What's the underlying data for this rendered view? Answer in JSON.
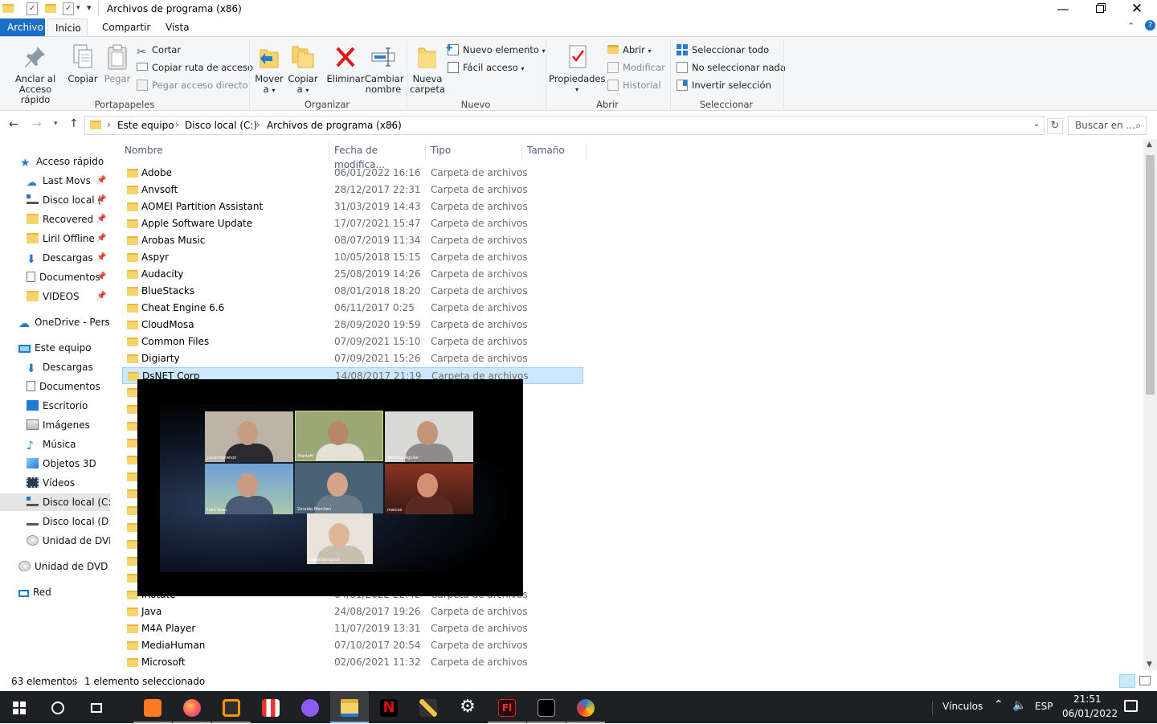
{
  "window": {
    "title": "Archivos de programa (x86)",
    "minimize_icon": "minimize-icon",
    "maximize_icon": "restore-icon",
    "close_icon": "close-icon"
  },
  "ribbon_tabs": [
    "Archivo",
    "Inicio",
    "Compartir",
    "Vista"
  ],
  "ribbon": {
    "clipboard": {
      "pin_label_1": "Anclar al",
      "pin_label_2": "Acceso rápido",
      "copy": "Copiar",
      "paste": "Pegar",
      "cut": "Cortar",
      "copy_path": "Copiar ruta de acceso",
      "paste_shortcut": "Pegar acceso directo",
      "group": "Portapapeles"
    },
    "organize": {
      "move_1": "Mover",
      "move_2": "a",
      "copy_1": "Copiar",
      "copy_2": "a",
      "delete": "Eliminar",
      "rename_1": "Cambiar",
      "rename_2": "nombre",
      "group": "Organizar"
    },
    "new": {
      "new_folder_1": "Nueva",
      "new_folder_2": "carpeta",
      "new_item": "Nuevo elemento",
      "easy_access": "Fácil acceso",
      "group": "Nuevo"
    },
    "open": {
      "properties": "Propiedades",
      "open": "Abrir",
      "edit": "Modificar",
      "history": "Historial",
      "group": "Abrir"
    },
    "select": {
      "select_all": "Seleccionar todo",
      "select_none": "No seleccionar nada",
      "invert": "Invertir selección",
      "group": "Seleccionar"
    }
  },
  "address": {
    "crumbs": [
      "Este equipo",
      "Disco local (C:)",
      "Archivos de programa (x86)"
    ],
    "search_placeholder": "Buscar en ..."
  },
  "nav_pane": {
    "quick_access": "Acceso rápido",
    "pinned": [
      "Last Movs",
      "Disco local (",
      "Recovered",
      "Liril Offline",
      "Descargas",
      "Documentos",
      "VIDEOS"
    ],
    "onedrive": "OneDrive - Perso",
    "this_pc": "Este equipo",
    "pc_items": [
      "Descargas",
      "Documentos",
      "Escritorio",
      "Imágenes",
      "Música",
      "Objetos 3D",
      "Vídeos",
      "Disco local (C:)",
      "Disco local (D:)",
      "Unidad de DVD"
    ],
    "dvd": "Unidad de DVD R",
    "network": "Red"
  },
  "columns": [
    "Nombre",
    "Fecha de modifica...",
    "Tipo",
    "Tamaño"
  ],
  "files": [
    {
      "name": "Adobe",
      "date": "06/01/2022 16:16",
      "type": "Carpeta de archivos"
    },
    {
      "name": "Anvsoft",
      "date": "28/12/2017 22:31",
      "type": "Carpeta de archivos"
    },
    {
      "name": "AOMEI Partition Assistant",
      "date": "31/03/2019 14:43",
      "type": "Carpeta de archivos"
    },
    {
      "name": "Apple Software Update",
      "date": "17/07/2021 15:47",
      "type": "Carpeta de archivos"
    },
    {
      "name": "Arobas Music",
      "date": "08/07/2019 11:34",
      "type": "Carpeta de archivos"
    },
    {
      "name": "Aspyr",
      "date": "10/05/2018 15:15",
      "type": "Carpeta de archivos"
    },
    {
      "name": "Audacity",
      "date": "25/08/2019 14:26",
      "type": "Carpeta de archivos"
    },
    {
      "name": "BlueStacks",
      "date": "08/01/2018 18:20",
      "type": "Carpeta de archivos"
    },
    {
      "name": "Cheat Engine 6.6",
      "date": "06/11/2017 0:25",
      "type": "Carpeta de archivos"
    },
    {
      "name": "CloudMosa",
      "date": "28/09/2020 19:59",
      "type": "Carpeta de archivos"
    },
    {
      "name": "Common Files",
      "date": "07/09/2021 15:10",
      "type": "Carpeta de archivos"
    },
    {
      "name": "Digiarty",
      "date": "07/09/2021 15:26",
      "type": "Carpeta de archivos"
    },
    {
      "name": "DsNET Corp",
      "date": "14/08/2017 21:19",
      "type": "Carpeta de archivos"
    },
    {
      "name": "Java",
      "date": "24/08/2017 19:26",
      "type": "Carpeta de archivos"
    },
    {
      "name": "M4A Player",
      "date": "11/07/2019 13:31",
      "type": "Carpeta de archivos"
    },
    {
      "name": "MediaHuman",
      "date": "07/10/2017 20:54",
      "type": "Carpeta de archivos"
    },
    {
      "name": "Microsoft",
      "date": "02/06/2021 11:32",
      "type": "Carpeta de archivos"
    }
  ],
  "partial_row": {
    "name": "iRotate",
    "date": "04/01/2022 22:42",
    "type": "Carpeta de archivos"
  },
  "status": {
    "count": "63 elementos",
    "selected": "1 elemento seleccionado"
  },
  "video_overlay": {
    "participants": [
      "javiermaranon",
      "MartoM",
      "Alencha Aguilar",
      "Ivan Grau",
      "Zoraida Marchen",
      "marcos",
      "isabel bongiolo"
    ]
  },
  "taskbar": {
    "links": "Vínculos",
    "lang": "ESP",
    "time": "21:51",
    "date": "06/01/2022"
  },
  "colors": {
    "accent": "#1a6fc4",
    "selection": "#cce8ff",
    "folder": "#f6d36b",
    "taskbar": "#1f2024"
  }
}
